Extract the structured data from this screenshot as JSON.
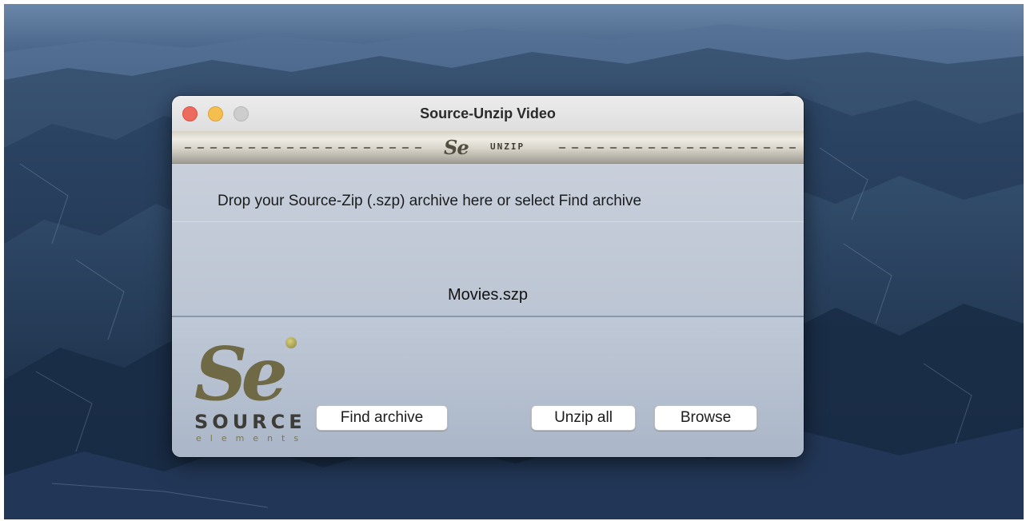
{
  "window": {
    "title": "Source-Unzip Video"
  },
  "brand_bar": {
    "logo_text": "Se",
    "app_tag": "UNZIP"
  },
  "drop_area": {
    "instruction": "Drop your Source-Zip (.szp) archive here or select Find archive",
    "selected_file": "Movies.szp"
  },
  "logo": {
    "mark": "Se",
    "wordmark": "SOURCE",
    "subword": "elements"
  },
  "buttons": {
    "find_archive": "Find archive",
    "unzip_all": "Unzip all",
    "browse": "Browse"
  },
  "colors": {
    "close": "#ed6a5e",
    "minimize": "#f5bf4f",
    "zoom_disabled": "#cdcdcd",
    "logo_olive": "#6f6a45"
  }
}
